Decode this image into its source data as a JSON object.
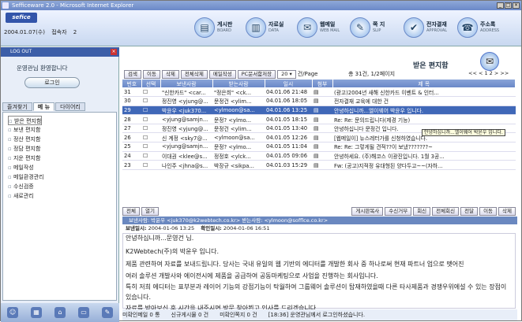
{
  "window": {
    "title": "Sefficeware 2.0 - Microsoft Internet Explorer"
  },
  "header": {
    "logo": "sefice",
    "date": "2004.01.07(수)",
    "online": "접속자",
    "online_count": "2"
  },
  "nav": [
    {
      "icon": "board-icon",
      "ko": "게시판",
      "en": "BOARD"
    },
    {
      "icon": "data-icon",
      "ko": "자료실",
      "en": "DATA"
    },
    {
      "icon": "webmail-icon",
      "ko": "웹메일",
      "en": "WEB MAIL"
    },
    {
      "icon": "note-icon",
      "ko": "쪽 지",
      "en": "SLIP"
    },
    {
      "icon": "approval-icon",
      "ko": "전자결재",
      "en": "APPROVAL"
    },
    {
      "icon": "address-icon",
      "ko": "주소록",
      "en": "ADDRESS"
    }
  ],
  "left": {
    "top_label": "LOG OUT",
    "welcome": "운영관님 환영합니다",
    "login_button": "로그인",
    "tabs": [
      "즐겨찾기",
      "메 뉴",
      "다이어리"
    ],
    "menu": [
      "받은 편지함",
      "보낸 편지함",
      "정산 편지함",
      "정담 편지함",
      "지운 편지함",
      "메일작성",
      "메일환경관리",
      "수신검증",
      "새로관리"
    ]
  },
  "main": {
    "title": "받은 편지함",
    "toolbar": [
      "검색",
      "이동",
      "삭제",
      "전체삭제",
      "메일작성",
      "PC문서함저장"
    ],
    "page_size": "20",
    "page_size_suffix": "건/Page",
    "page_info": "총 31건, 1/2페이지",
    "pager": "<< < 1 2 > >>",
    "columns": [
      "번호",
      "선택",
      "보낸사람",
      "받는사람",
      "일시",
      "첨부",
      "제 목"
    ],
    "rows": [
      {
        "no": "31",
        "from": "\"신한카드\" <car...",
        "to": "\"정은희\" <ck...",
        "date": "04.01.06 21:48",
        "subject": "(광고)2004년 새해 신한카드 이벤트 & 인터..."
      },
      {
        "no": "30",
        "from": "정진영 <yjung@...",
        "to": "문정건 <ylim...",
        "date": "04.01.06 18:05",
        "subject": "전자결재 교육에 대한 건"
      },
      {
        "no": "29",
        "from": "박윤우 <juk370...",
        "to": "<ylmoon@sa...",
        "date": "04.01.06 13:25",
        "subject": "안녕하십니까...엘이웨어 박윤우 입니다."
      },
      {
        "no": "28",
        "from": "<yjung@samjn...",
        "to": "문정? <ylmo...",
        "date": "04.01.05 18:15",
        "subject": "Re: Re: 문의드립니다(제경 기능)"
      },
      {
        "no": "27",
        "from": "정진영 <yjung@...",
        "to": "문정건 <ylim...",
        "date": "04.01.05 13:40",
        "subject": "안녕하십니다 문정건 입니다."
      },
      {
        "no": "26",
        "from": "신 계정 <sky7@...",
        "to": "<ylmoon@sa...",
        "date": "04.01.05 12:26",
        "subject": "[웹메일이] 뉴스레터가를 신청하였습니다."
      },
      {
        "no": "25",
        "from": "<yjung@samjn...",
        "to": "문정? <ylmo...",
        "date": "04.01.05 11:04",
        "subject": "Re: Re: 그렇게될 견적??이 보냈???????~"
      },
      {
        "no": "24",
        "from": "이대권 <klee@s...",
        "to": "정정호 <ylck...",
        "date": "04.01.05 09:06",
        "subject": "안녕하세요. (주)해코스 이광진입니다. 1월 3공..."
      },
      {
        "no": "23",
        "from": "나인주 <jhna@s...",
        "to": "박장규 <sikpa...",
        "date": "04.01.03 15:29",
        "subject": "Fw: (공고)지적정 유대형된 양다두고~~(자하..."
      }
    ],
    "tooltip": "안녕하십니까...엘이웨어 박윤우 입니다.",
    "action_left": [
      "전체",
      "열기"
    ],
    "action_right": [
      "게시판복사",
      "수신거부",
      "회신",
      "전체회신",
      "전달",
      "이동",
      "삭제"
    ],
    "info": "보낸사람: 박윤우 <juk370@k2webtech.co.kr>    받는사람: <ylmoon@sofflce.co.kr>",
    "date_label": "보낸일시:",
    "date_value": "2004-01-06 13:25",
    "read_label": "확인일시:",
    "read_value": "2004-01-06 16:51",
    "body": [
      "안녕하십니까...문영건 님.",
      "K2Webtech(주)의 박윤우 입니다.",
      "제품 관련하여 자료를 보내드립니다. 당사는 국내 유일의 웹 기반의 에디터를 개발한 회사 중 하나로써 현재 파트너 업으로 뗏어진",
      "여러 솔루션 개발사와 에이전시에 제품을 공급하여 공동마케팅으로 사업을 진행하는 회사입니다.",
      "특히 저희 에디터는 표부분과 레이어 기능의 강점기능이 탁월하여 그룹웨어 솔루션이 탑재하였을때 다른 타사제품과 경쟁우위에설 수 있는 장점이 있습니다.",
      "자료를 받아보신 후 시간을 내주시면 방문 찾아뵙고 인사를 드리겠습니다."
    ]
  },
  "status": [
    "미확인메일 0 통",
    "신규게시물 0 건",
    "미확인쪽지 0 건",
    "[18:36] 운영관님께서 로그인하셨습니다."
  ]
}
